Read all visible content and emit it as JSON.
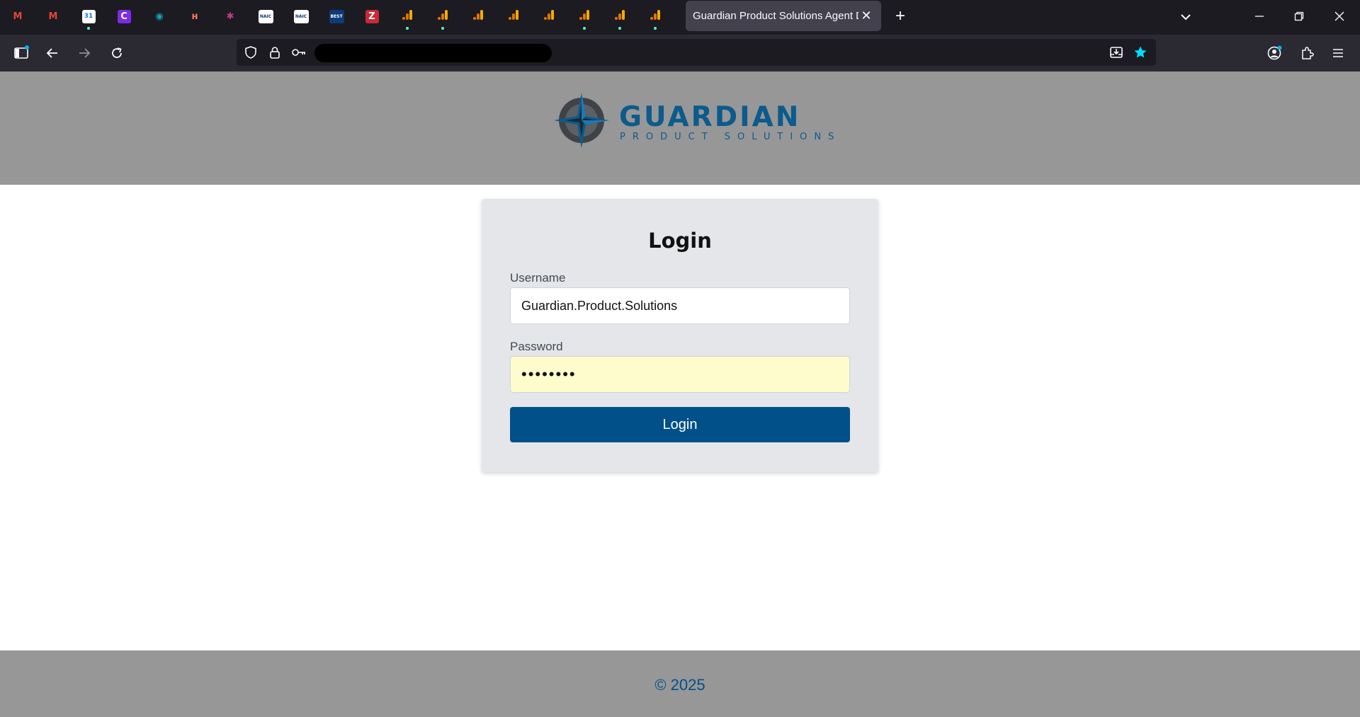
{
  "browser": {
    "pinned_tabs": [
      {
        "icon": "gmail-icon",
        "glyph": "M",
        "color": "#ea4335",
        "bg": "transparent",
        "loaded": false
      },
      {
        "icon": "gmail-icon",
        "glyph": "M",
        "color": "#ea4335",
        "bg": "transparent",
        "loaded": false
      },
      {
        "icon": "calendar-icon",
        "glyph": "31",
        "color": "#1a73e8",
        "bg": "#ffffff",
        "loaded": true
      },
      {
        "icon": "canva-icon",
        "glyph": "C",
        "color": "#ffffff",
        "bg": "#7d2ae8",
        "loaded": false
      },
      {
        "icon": "globe-icon",
        "glyph": "◉",
        "color": "#10a3b5",
        "bg": "transparent",
        "loaded": false
      },
      {
        "icon": "hubspot-icon",
        "glyph": "ʜ",
        "color": "#ff7a59",
        "bg": "transparent",
        "loaded": false
      },
      {
        "icon": "pinwheel-icon",
        "glyph": "✱",
        "color": "#c73a8e",
        "bg": "transparent",
        "loaded": false
      },
      {
        "icon": "naic-icon",
        "glyph": "NAIC",
        "color": "#0b3b6f",
        "bg": "#ffffff",
        "loaded": false
      },
      {
        "icon": "naic-icon",
        "glyph": "NAIC",
        "color": "#0b3b6f",
        "bg": "#ffffff",
        "loaded": false
      },
      {
        "icon": "am-best-icon",
        "glyph": "BEST",
        "color": "#ffffff",
        "bg": "#0d3b78",
        "loaded": false
      },
      {
        "icon": "zotero-icon",
        "glyph": "Z",
        "color": "#ffffff",
        "bg": "#cc2936",
        "loaded": false
      },
      {
        "icon": "analytics-icon",
        "glyph": "",
        "color": "#f9ab00",
        "bg": "transparent",
        "loaded": true
      },
      {
        "icon": "analytics-icon",
        "glyph": "",
        "color": "#f9ab00",
        "bg": "transparent",
        "loaded": true
      },
      {
        "icon": "analytics-icon",
        "glyph": "",
        "color": "#f9ab00",
        "bg": "transparent",
        "loaded": false
      },
      {
        "icon": "analytics-icon",
        "glyph": "",
        "color": "#f9ab00",
        "bg": "transparent",
        "loaded": false
      },
      {
        "icon": "analytics-icon",
        "glyph": "",
        "color": "#f9ab00",
        "bg": "transparent",
        "loaded": false
      },
      {
        "icon": "analytics-icon",
        "glyph": "",
        "color": "#f9ab00",
        "bg": "transparent",
        "loaded": true
      },
      {
        "icon": "analytics-icon",
        "glyph": "",
        "color": "#f9ab00",
        "bg": "transparent",
        "loaded": true
      },
      {
        "icon": "analytics-icon",
        "glyph": "",
        "color": "#f9ab00",
        "bg": "transparent",
        "loaded": true
      }
    ],
    "active_tab_title": "Guardian Product Solutions Agent D"
  },
  "page": {
    "logo": {
      "brand": "GUARDIAN",
      "subtitle": "PRODUCT SOLUTIONS"
    },
    "login": {
      "heading": "Login",
      "username_label": "Username",
      "username_value": "Guardian.Product.Solutions",
      "password_label": "Password",
      "password_value": "••••••••",
      "submit_label": "Login"
    },
    "footer": "© 2025"
  },
  "colors": {
    "accent": "#01508a",
    "header_bg": "#979797",
    "card_bg": "#e4e6ea",
    "autofill_bg": "#fefbcc"
  }
}
